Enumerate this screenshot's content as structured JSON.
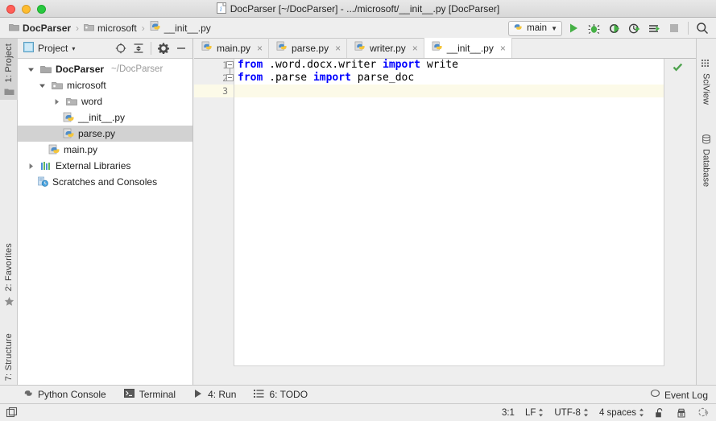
{
  "window": {
    "title": "DocParser [~/DocParser] - .../microsoft/__init__.py [DocParser]",
    "title_icon": "python-file-icon",
    "traffic_lights": [
      "close-button",
      "minimize-button",
      "maximize-button"
    ]
  },
  "navbar": {
    "breadcrumbs": [
      {
        "label": "DocParser",
        "icon": "folder-icon"
      },
      {
        "label": "microsoft",
        "icon": "package-folder-icon"
      },
      {
        "label": "__init__.py",
        "icon": "python-file-icon"
      }
    ],
    "separator": "›",
    "run_config": {
      "label": "main",
      "icon": "python-icon",
      "arrow": "▼"
    },
    "buttons": [
      {
        "name": "run-button",
        "icon": "play-icon",
        "color": "#4caf50"
      },
      {
        "name": "debug-button",
        "icon": "bug-icon",
        "color": "#4caf50"
      },
      {
        "name": "run-coverage-button",
        "icon": "coverage-icon",
        "color": "#4caf50"
      },
      {
        "name": "profile-button",
        "icon": "profile-icon",
        "color": "#4caf50"
      },
      {
        "name": "run-with-console-button",
        "icon": "run-console-icon",
        "color": "#4caf50"
      },
      {
        "name": "stop-button",
        "icon": "stop-icon",
        "color": "#b0b0b0"
      },
      {
        "name": "search-everywhere-button",
        "icon": "search-icon",
        "color": "#3c3c3c"
      }
    ]
  },
  "left_stripe": {
    "tabs": [
      {
        "label": "1: Project",
        "icon": "folder-icon",
        "active": true
      },
      {
        "label": "2: Favorites",
        "icon": "star-icon",
        "active": false
      },
      {
        "label": "7: Structure",
        "icon": "structure-icon",
        "active": false
      }
    ]
  },
  "right_stripe": {
    "tabs": [
      {
        "label": "SciView",
        "icon": "grid-icon"
      },
      {
        "label": "Database",
        "icon": "database-icon"
      }
    ]
  },
  "project_panel": {
    "title": "Project",
    "title_arrow": "▾",
    "actions": [
      {
        "name": "locate-button",
        "icon": "crosshair-icon"
      },
      {
        "name": "collapse-all-button",
        "icon": "collapse-all-icon"
      },
      {
        "name": "settings-button",
        "icon": "gear-icon"
      },
      {
        "name": "hide-button",
        "icon": "minimize-icon"
      }
    ],
    "tree": [
      {
        "name": "tree-item-docparser",
        "label": "DocParser",
        "path": "~/DocParser",
        "icon": "folder-icon",
        "arrow": "▾",
        "indent": 0,
        "bold": true,
        "selected": false
      },
      {
        "name": "tree-item-microsoft",
        "label": "microsoft",
        "path": "",
        "icon": "package-folder-icon",
        "arrow": "▾",
        "indent": 1,
        "bold": false,
        "selected": false
      },
      {
        "name": "tree-item-word",
        "label": "word",
        "path": "",
        "icon": "package-folder-icon",
        "arrow": "▸",
        "indent": 2,
        "bold": false,
        "selected": false
      },
      {
        "name": "tree-item-init-py",
        "label": "__init__.py",
        "path": "",
        "icon": "python-file-icon",
        "arrow": "",
        "indent": 3,
        "bold": false,
        "selected": false
      },
      {
        "name": "tree-item-parse-py",
        "label": "parse.py",
        "path": "",
        "icon": "python-file-icon",
        "arrow": "",
        "indent": 3,
        "bold": false,
        "selected": true
      },
      {
        "name": "tree-item-main-py",
        "label": "main.py",
        "path": "",
        "icon": "python-file-icon",
        "arrow": "",
        "indent": 1,
        "bold": false,
        "selected": false
      },
      {
        "name": "tree-item-external-libraries",
        "label": "External Libraries",
        "path": "",
        "icon": "libraries-icon",
        "arrow": "▸",
        "indent": 0,
        "bold": false,
        "selected": false
      },
      {
        "name": "tree-item-scratches",
        "label": "Scratches and Consoles",
        "path": "",
        "icon": "scratches-icon",
        "arrow": "",
        "indent": 0,
        "bold": false,
        "selected": false
      }
    ]
  },
  "editor": {
    "tabs": [
      {
        "label": "main.py",
        "icon": "python-file-icon",
        "active": false,
        "close": "×"
      },
      {
        "label": "parse.py",
        "icon": "python-file-icon",
        "active": false,
        "close": "×"
      },
      {
        "label": "writer.py",
        "icon": "python-file-icon",
        "active": false,
        "close": "×"
      },
      {
        "label": "__init__.py",
        "icon": "python-file-icon",
        "active": true,
        "close": "×"
      }
    ],
    "gutter_numbers": [
      "1",
      "2",
      "3"
    ],
    "lines": [
      {
        "number": "1",
        "tokens": [
          {
            "t": "from",
            "k": true
          },
          {
            "t": " .word.docx.writer ",
            "k": false
          },
          {
            "t": "import",
            "k": true
          },
          {
            "t": " write",
            "k": false
          }
        ],
        "current": false,
        "fold": "open"
      },
      {
        "number": "2",
        "tokens": [
          {
            "t": "from",
            "k": true
          },
          {
            "t": " .parse ",
            "k": false
          },
          {
            "t": "import",
            "k": true
          },
          {
            "t": " parse_doc",
            "k": false
          }
        ],
        "current": false,
        "fold": "single"
      },
      {
        "number": "3",
        "tokens": [
          {
            "t": "",
            "k": false
          }
        ],
        "current": true,
        "fold": ""
      }
    ],
    "inspection_status": {
      "name": "inspection-ok-icon",
      "glyph": "✔",
      "color": "#5aa45a"
    }
  },
  "bottom_bar": {
    "buttons": [
      {
        "name": "python-console-button",
        "label": "Python Console",
        "icon": "python-console-icon"
      },
      {
        "name": "terminal-button",
        "label": "Terminal",
        "icon": "terminal-icon"
      },
      {
        "name": "run-tool-button",
        "label": "4: Run",
        "underline": "4",
        "icon": "play-icon"
      },
      {
        "name": "todo-tool-button",
        "label": "6: TODO",
        "underline": "6",
        "icon": "list-icon"
      }
    ],
    "event_log": {
      "label": "Event Log",
      "icon": "balloon-icon"
    }
  },
  "status_bar": {
    "left_icon": "layout-icon",
    "caret_position": "3:1",
    "line_separator": "LF",
    "encoding": "UTF-8",
    "indent": "4 spaces",
    "lock_icon": "unlocked-icon",
    "inspection_icon": "inspector-icon",
    "help_icon": "help-icon",
    "spinner": "↕"
  },
  "colors": {
    "accent_green": "#4caf50",
    "keyword_blue": "#0000ff",
    "selection_gray": "#d2d2d2",
    "current_line": "#fcfae8",
    "chrome": "#eeeeee"
  }
}
